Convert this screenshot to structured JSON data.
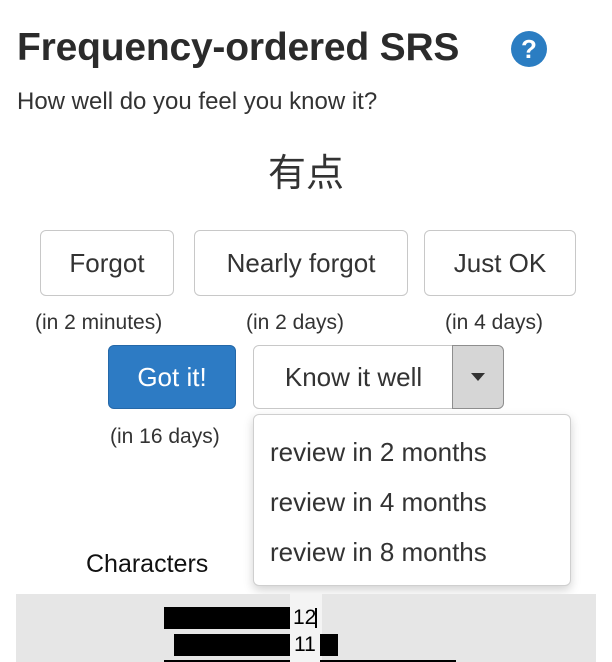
{
  "header": {
    "title": "Frequency-ordered SRS",
    "help_icon": "?"
  },
  "prompt": "How well do you feel you know it?",
  "word": "有点",
  "buttons": [
    {
      "label": "Forgot",
      "hint": "(in 2 minutes)"
    },
    {
      "label": "Nearly forgot",
      "hint": "(in 2 days)"
    },
    {
      "label": "Just OK",
      "hint": "(in 4 days)"
    },
    {
      "label": "Got it!",
      "hint": "(in 16 days)"
    }
  ],
  "know_well": {
    "label": "Know it well",
    "caret": "chevron-down-icon"
  },
  "dropdown": {
    "items": [
      "review in 2 months",
      "review in 4 months",
      "review in 8 months"
    ]
  },
  "characters": {
    "label": "Characters",
    "bars": [
      {
        "value": "12"
      },
      {
        "value": "11"
      }
    ]
  },
  "colors": {
    "primary": "#2d7bc4",
    "help": "#2b7dc2"
  }
}
